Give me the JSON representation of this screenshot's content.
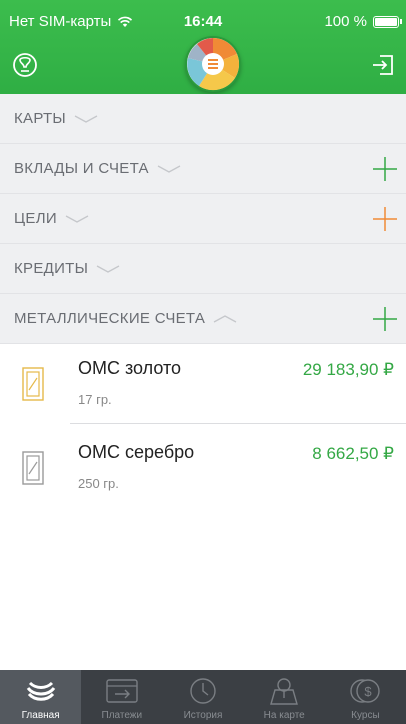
{
  "status_bar": {
    "carrier": "Нет SIM-карты",
    "time": "16:44",
    "battery": "100 %"
  },
  "header": {
    "profile_icon": "profile-icon",
    "logout_icon": "logout-icon",
    "logo_icon": "wallet-logo-icon"
  },
  "sections": [
    {
      "label": "КАРТЫ",
      "expanded": false,
      "has_add": false
    },
    {
      "label": "ВКЛАДЫ И СЧЕТА",
      "expanded": false,
      "has_add": true,
      "add_color": "#34a845"
    },
    {
      "label": "ЦЕЛИ",
      "expanded": false,
      "has_add": true,
      "add_color": "#f08a36"
    },
    {
      "label": "КРЕДИТЫ",
      "expanded": false,
      "has_add": false
    },
    {
      "label": "МЕТАЛЛИЧЕСКИЕ СЧЕТА",
      "expanded": true,
      "has_add": true,
      "add_color": "#34a845"
    }
  ],
  "accounts": [
    {
      "name": "ОМС золото",
      "sub": "17 гр.",
      "amount": "29 183,90 ₽",
      "icon_color": "#e5b94a"
    },
    {
      "name": "ОМС серебро",
      "sub": "250 гр.",
      "amount": "8 662,50 ₽",
      "icon_color": "#9a9a9a"
    }
  ],
  "tabs": [
    {
      "label": "Главная",
      "active": true,
      "icon": "sberbank-logo-icon"
    },
    {
      "label": "Платежи",
      "active": false,
      "icon": "transfer-card-icon"
    },
    {
      "label": "История",
      "active": false,
      "icon": "clock-icon"
    },
    {
      "label": "На карте",
      "active": false,
      "icon": "map-pin-icon"
    },
    {
      "label": "Курсы",
      "active": false,
      "icon": "currency-icon"
    }
  ],
  "colors": {
    "brand_green": "#34a845",
    "header_green": "#3cbd4d",
    "section_bg": "#eff0f2",
    "tabbar_bg": "#3b3f44",
    "goal_orange": "#f08a36"
  }
}
